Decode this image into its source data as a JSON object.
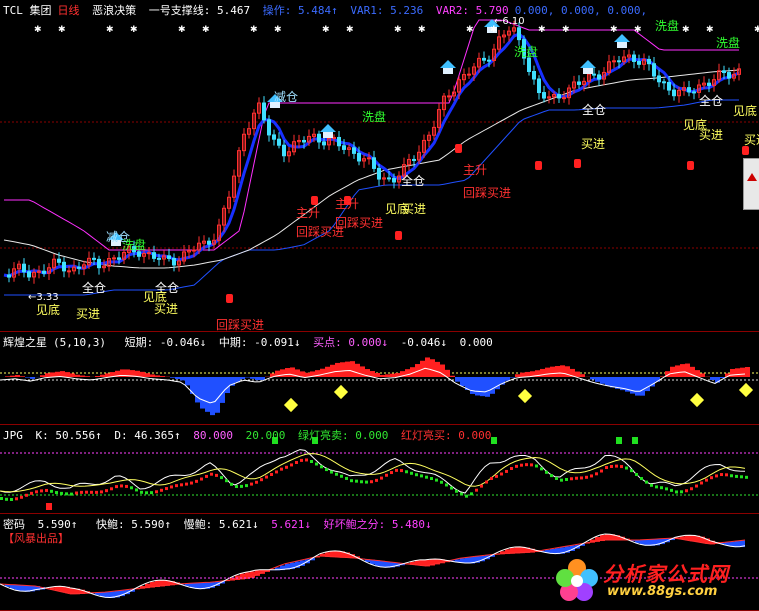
{
  "main": {
    "header": {
      "symbol": "TCL 集团",
      "period": "日线",
      "indicator": "恶浪决策",
      "support_label": "一号支撑线: 5.467",
      "op_label": "操作: 5.484↑",
      "var1": "VAR1: 5.236",
      "var2": "VAR2: 5.790",
      "vals": "0.000, 0.000, 0.000,"
    },
    "price_high": "6.10",
    "price_low": "3.33",
    "labels": {
      "jiancang1": "减仓",
      "jiancang2": "减仓",
      "xipan1": "洗盘",
      "xipan2": "洗盘",
      "xipan3": "洗盘",
      "xipan4": "洗盘",
      "quancang1": "全仓",
      "quancang2": "全仓",
      "quancang3": "全仓",
      "quancang4": "全仓",
      "quancang5": "全仓",
      "jiandi1": "见底",
      "jiandi2": "见底",
      "jiandi3": "见底",
      "jiandi4": "见底",
      "jiandi5": "见底",
      "maijin1": "买进",
      "maijin2": "买进",
      "maijin3": "买进",
      "maijin4": "买进",
      "maijin5": "买进",
      "maijin6": "买进",
      "zhusheng1": "主升",
      "zhusheng2": "主升",
      "zhusheng3": "主升",
      "huicai1": "回踩买进",
      "huicai2": "回踩买进",
      "huicai3": "回踩买进",
      "huicai4": "回踩买进"
    }
  },
  "huihuang": {
    "header": {
      "title": "辉煌之星",
      "params": "(5,10,3)",
      "short": "短期: -0.046↓",
      "mid": "中期: -0.091↓",
      "buy": "买点: 0.000↓",
      "v1": "-0.046↓",
      "v2": "0.000"
    }
  },
  "jpg": {
    "header": {
      "title": "JPG",
      "k": "K: 50.556↑",
      "d": "D: 46.365↑",
      "v80": "80.000",
      "v20": "20.000",
      "green": "绿灯亮卖: 0.000",
      "red": "红灯亮买: 0.000"
    }
  },
  "mima": {
    "header": {
      "title": "密码",
      "v": "5.590↑",
      "kuai": "快鲍: 5.590↑",
      "man": "慢鲍: 5.621↓",
      "v2": "5.621↓",
      "haohuai": "好坏鲍之分: 5.480↓"
    },
    "tag": "【风暴出品】"
  },
  "watermark": {
    "name": "分析家公式网",
    "url": "www.88gs.com"
  },
  "colors": {
    "up": "#ff3030",
    "down": "#40e0ff",
    "blue_line": "#2040ff",
    "magenta": "#ff30ff",
    "panel_border": "#8b0000"
  }
}
